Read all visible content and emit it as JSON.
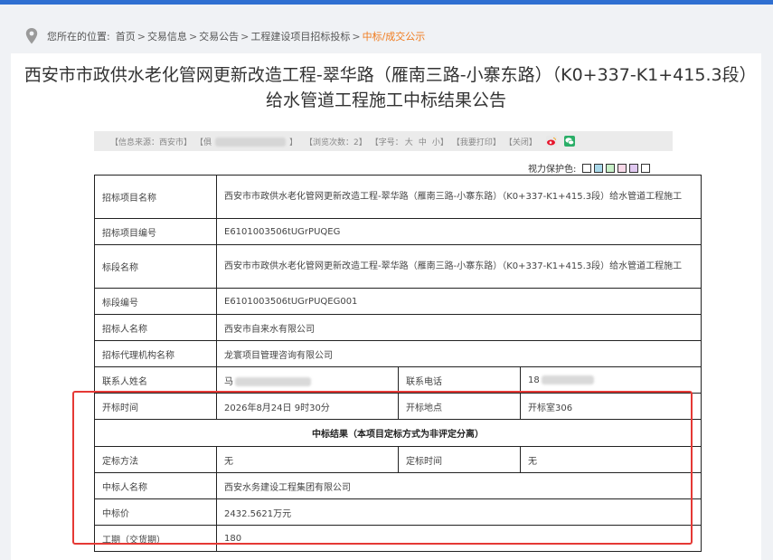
{
  "breadcrumb": {
    "prefix": "您所在的位置:",
    "items": [
      "首页",
      "交易信息",
      "交易公告",
      "工程建设项目招标投标"
    ],
    "current": "中标/成交公示"
  },
  "title": "西安市市政供水老化管网更新改造工程-翠华路（雁南三路-小寨东路）（K0+337-K1+415.3段）给水管道工程施工中标结果公告",
  "infobar": {
    "source": "【信息来源：西安市】",
    "date_prefix": "【俱",
    "date_suffix": "】",
    "views": "【浏览次数：2】",
    "font_size_label": "【字号：",
    "font_large": "大",
    "font_medium": "中",
    "font_small": "小】",
    "print": "【我要打印】",
    "close": "【关闭】"
  },
  "vision": {
    "label": "视力保护色:",
    "colors": [
      "#ffffff",
      "#a8d8ea",
      "#c8f0c8",
      "#f8d8e8",
      "#e0c8f0",
      "#ffffff"
    ]
  },
  "table": {
    "project_name_label": "招标项目名称",
    "project_name_value": "西安市市政供水老化管网更新改造工程-翠华路（雁南三路-小寨东路）（K0+337-K1+415.3段）给水管道工程施工",
    "project_code_label": "招标项目编号",
    "project_code_value": "E6101003506tUGrPUQEG",
    "section_name_label": "标段名称",
    "section_name_value": "西安市市政供水老化管网更新改造工程-翠华路（雁南三路-小寨东路）（K0+337-K1+415.3段）给水管道工程施工",
    "section_code_label": "标段编号",
    "section_code_value": "E6101003506tUGrPUQEG001",
    "tenderer_label": "招标人名称",
    "tenderer_value": "西安市自来水有限公司",
    "agency_label": "招标代理机构名称",
    "agency_value": "龙寰项目管理咨询有限公司",
    "contact_label": "联系人姓名",
    "contact_value_prefix": "马",
    "phone_label": "联系电话",
    "phone_value_prefix": "18",
    "open_time_label": "开标时间",
    "open_time_value": "2026年8月24日 9时30分",
    "open_place_label": "开标地点",
    "open_place_value": "开标室306",
    "result_header": "中标结果（本项目定标方式为非评定分离）",
    "method_label": "定标方法",
    "method_value": "无",
    "decide_time_label": "定标时间",
    "decide_time_value": "无",
    "winner_label": "中标人名称",
    "winner_value": "西安水务建设工程集团有限公司",
    "price_label": "中标价",
    "price_value": "2432.5621万元",
    "period_label": "工期（交货期）",
    "period_value": "180"
  }
}
